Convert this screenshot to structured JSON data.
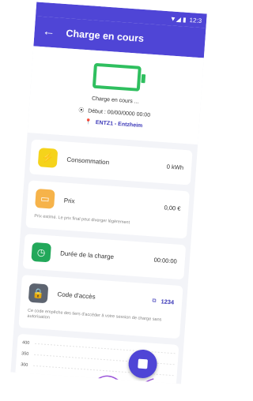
{
  "status_bar": {
    "signal": "▼◢ ▮",
    "time": "12:3"
  },
  "app_bar": {
    "back_icon": "arrow-left-icon",
    "title": "Charge en cours"
  },
  "hero": {
    "status": "Charge en cours ...",
    "start_label": "Début : 00/00/0000 00:00",
    "station": "ENTZ1 - Entzheim"
  },
  "consumption": {
    "label": "Consommation",
    "value": "0 kWh"
  },
  "price": {
    "label": "Prix",
    "value": "0,00 €",
    "note": "Prix estimé. Le prix final peut diverger légèrement"
  },
  "duration": {
    "label": "Durée de la charge",
    "value": "00:00:00"
  },
  "access_code": {
    "label": "Code d'accès",
    "value": "1234",
    "note": "Ce code empêche des tiers d'accéder à votre session de charge sans autorisation"
  },
  "chart": {
    "y_ticks": [
      "400",
      "350",
      "300"
    ]
  },
  "colors": {
    "primary": "#4f45d6",
    "battery": "#2fbf5f",
    "consumption": "#f5d31b",
    "price": "#f6b34a",
    "duration": "#22a85a",
    "access": "#5d6470"
  }
}
